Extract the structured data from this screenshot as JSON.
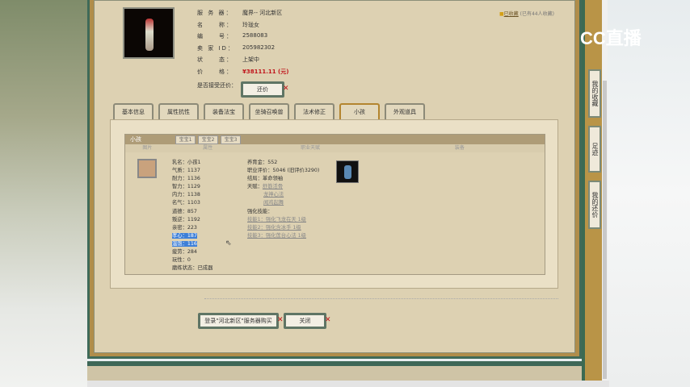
{
  "listing": {
    "server_label": "服 务 器：",
    "server": "魔界-- 河北新区",
    "name_label": "名　　称：",
    "name": "玲珑女",
    "id_label": "编　　号：",
    "id": "2588083",
    "seller_label": "卖 家 ID：",
    "seller": "205982302",
    "status_label": "状　　态：",
    "status": "上架中",
    "price_label": "价　　格：",
    "price": "¥38111.11 (元)",
    "bargain_label": "是否接受还价：",
    "bargain_button": "还价"
  },
  "favorite": {
    "link": "已收藏",
    "count": "(已有44人收藏)"
  },
  "tabs": [
    "基本信息",
    "属性抗性",
    "装备法宝",
    "坐骑召唤兽",
    "法术修正",
    "小孩",
    "外观道具"
  ],
  "child": {
    "title": "小孩",
    "subtabs": [
      "宝宝1",
      "宝宝2",
      "宝宝3"
    ],
    "columns": [
      "图片",
      "属性",
      "职业天赋",
      "装备"
    ],
    "attrs": [
      "乳名：小孩1",
      "气质：1137",
      "耐力：1136",
      "智力：1129",
      "内力：1138",
      "名气：1103",
      "道德：857",
      "叛逆：1192",
      "亲密：223",
      "孝心：187",
      "温饱：116",
      "疲劳：284",
      "玩性：0",
      "磨练状态：已成器"
    ],
    "job": {
      "money": "养育金：552",
      "score": "职业评价：5046 (旧评价3290)",
      "ending": "结局：革命领袖",
      "talent_label": "天赋：",
      "talents": [
        "舒筋活骨",
        "龙神心法",
        "闻鸡起舞"
      ],
      "skills_label": "强化技能：",
      "skills": [
        "技能1：强化飞龙在天 1级",
        "技能2：强化含冰手 1级",
        "技能3：强化莲台心法 1级"
      ]
    }
  },
  "buttons": {
    "login_buy": "登录\"河北新区\"服务器购买",
    "close": "关闭"
  },
  "sidebar": [
    "我的收藏",
    "足迹",
    "我的还价"
  ],
  "watermark": "CC直播"
}
